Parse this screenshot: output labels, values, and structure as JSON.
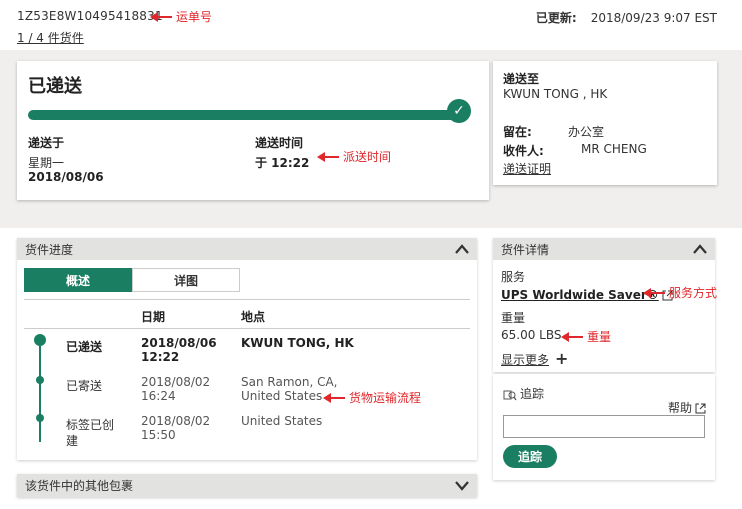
{
  "header": {
    "tracking_number": "1Z53E8W10495418831",
    "package_count": "1 / 4 件货件",
    "updated_label": "已更新:",
    "updated_value": "2018/09/23 9:07 EST"
  },
  "annotations": {
    "tracking": "运单号",
    "delivery_time": "派送时间",
    "service": "服务方式",
    "weight": "重量",
    "flow": "货物运输流程"
  },
  "status": {
    "title": "已递送",
    "progress_percent": 100,
    "delivered_on_label": "递送于",
    "delivered_day": "星期一",
    "delivered_date": "2018/08/06",
    "delivery_time_label": "递送时间",
    "delivery_time_value": "于 12:22"
  },
  "destination": {
    "label": "递送至",
    "place": "KWUN TONG , HK",
    "left_at_label": "留在:",
    "left_at_value": "办公室",
    "recipient_label": "收件人:",
    "recipient_value": "MR CHENG",
    "proof_link": "递送证明"
  },
  "progress": {
    "header": "货件进度",
    "tabs": [
      "概述",
      "详图"
    ],
    "columns": [
      "日期",
      "地点"
    ],
    "rows": [
      {
        "status": "已递送",
        "date": "2018/08/06",
        "time": "12:22",
        "location": "KWUN TONG, HK",
        "location2": ""
      },
      {
        "status": "已寄送",
        "date": "2018/08/02",
        "time": "16:24",
        "location": "San Ramon, CA,",
        "location2": "United States"
      },
      {
        "status": "标签已创",
        "status2": "建",
        "date": "2018/08/02",
        "time": "15:50",
        "location": "United States",
        "location2": ""
      }
    ]
  },
  "details": {
    "header": "货件详情",
    "service_label": "服务",
    "service_value": "UPS Worldwide Saver®",
    "weight_label": "重量",
    "weight_value": "65.00 LBS",
    "show_more": "显示更多"
  },
  "track": {
    "label": "追踪",
    "help": "帮助",
    "input_value": "",
    "button": "追踪"
  },
  "other_packages": {
    "header": "该货件中的其他包裹"
  },
  "colors": {
    "brand_green": "#1a7e62",
    "annotation_red": "#e0272b"
  }
}
